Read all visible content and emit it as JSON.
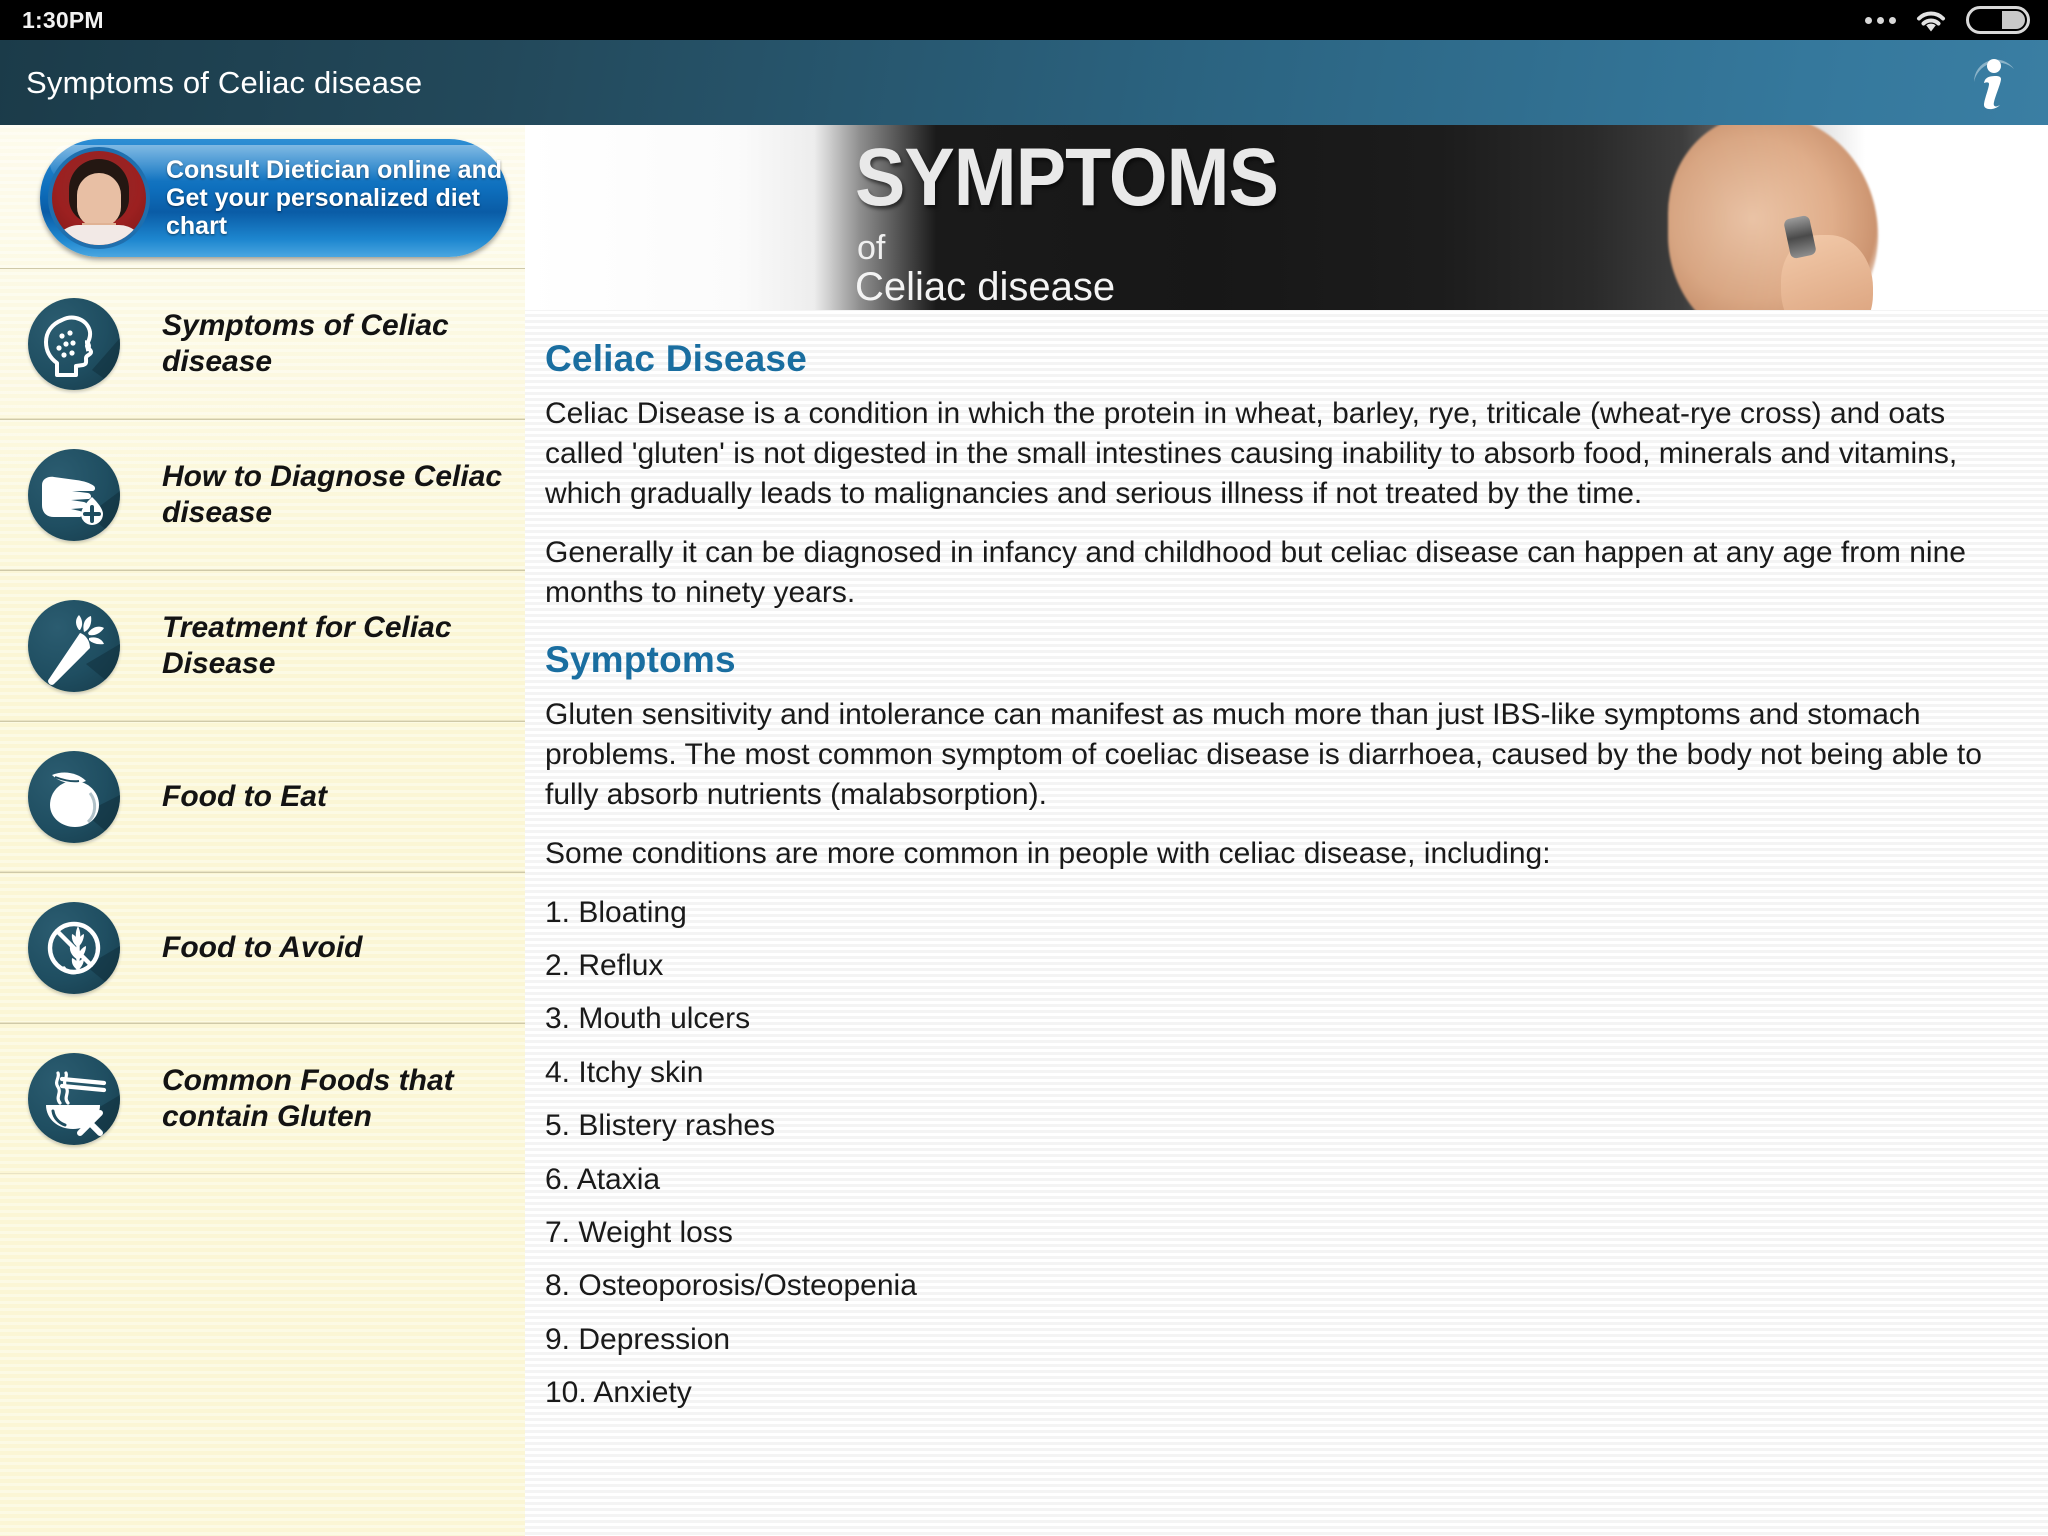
{
  "statusbar": {
    "time": "1:30PM",
    "icons": [
      "more-dots-icon",
      "wifi-icon",
      "battery-icon"
    ]
  },
  "appbar": {
    "title": "Symptoms of Celiac disease",
    "info_icon": "info-icon",
    "gradient_from": "#1b3b49",
    "gradient_to": "#3a7ea3"
  },
  "sidebar": {
    "background": "#fbf7d8",
    "promo": {
      "line1": "Consult Dietician online and",
      "line2": "Get your personalized diet chart",
      "avatar": "dietician-avatar",
      "accent": "#0e6fbd"
    },
    "items": [
      {
        "label": "Symptoms of Celiac disease",
        "icon": "head-rash-icon"
      },
      {
        "label": "How to Diagnose Celiac disease",
        "icon": "finger-blood-drop-icon"
      },
      {
        "label": "Treatment for Celiac Disease",
        "icon": "carrot-icon"
      },
      {
        "label": "Food to Eat",
        "icon": "mango-fruit-icon"
      },
      {
        "label": "Food to Avoid",
        "icon": "no-wheat-icon"
      },
      {
        "label": "Common Foods that contain Gluten",
        "icon": "noodle-bowl-chopsticks-icon"
      }
    ]
  },
  "content": {
    "hero": {
      "title": "SYMPTOMS",
      "of": "of",
      "subtitle": "Celiac disease",
      "image_alt": "hand-writing-symptoms-of-celiac-disease"
    },
    "heading_color": "#1a6ea0",
    "sections": [
      {
        "heading": "Celiac Disease",
        "paragraphs": [
          "Celiac Disease is a condition in which the protein in wheat, barley, rye, triticale (wheat-rye cross) and oats called 'gluten' is not digested in the small intestines causing inability to absorb food, minerals and vitamins, which gradually leads to malignancies and serious illness if not treated by the time.",
          "Generally it can be diagnosed in infancy and childhood but celiac disease can happen at any age from nine months to ninety years."
        ]
      },
      {
        "heading": "Symptoms",
        "paragraphs": [
          "Gluten sensitivity and intolerance can manifest as much more than just IBS-like symptoms and stomach problems. The most common symptom of coeliac disease is diarrhoea, caused by the body not being able to fully absorb nutrients (malabsorption).",
          "Some conditions are more common in people with celiac disease, including:"
        ],
        "list": [
          "1. Bloating",
          "2. Reflux",
          "3. Mouth ulcers",
          "4. Itchy skin",
          "5. Blistery rashes",
          "6. Ataxia",
          "7. Weight loss",
          "8. Osteoporosis/Osteopenia",
          "9. Depression",
          "10. Anxiety"
        ]
      }
    ]
  }
}
